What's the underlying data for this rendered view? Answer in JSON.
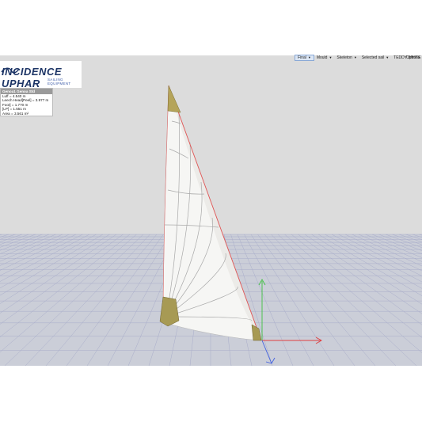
{
  "toolbar": {
    "items": [
      {
        "label": "Final"
      },
      {
        "label": "Mould"
      },
      {
        "label": "Skeleton"
      },
      {
        "label": "Selected sail"
      },
      {
        "label": "TEDDY WHITE"
      }
    ],
    "options_label": "Options"
  },
  "logo": {
    "brand": "INCIDENCE UPHAR",
    "tagline": "SAILING EQUIPMENT"
  },
  "info_panel": {
    "title": "Genoa1 Genoa Std",
    "rows": [
      "Luff = 4.540 m",
      "Leech Head[Peel] = 3.977 m",
      "Foot] = 1.770 m",
      "[LP] = 1.551 m",
      "Area = 3.561 m²"
    ]
  },
  "colors": {
    "background": "#dcdcdc",
    "floor": "#c9ccd6",
    "grid": "#a9adca",
    "luff_line": "#e05555",
    "reinforcement": "#b5a45a",
    "axis_x": "#e04040",
    "axis_y": "#40c040",
    "axis_z": "#4060e0"
  }
}
